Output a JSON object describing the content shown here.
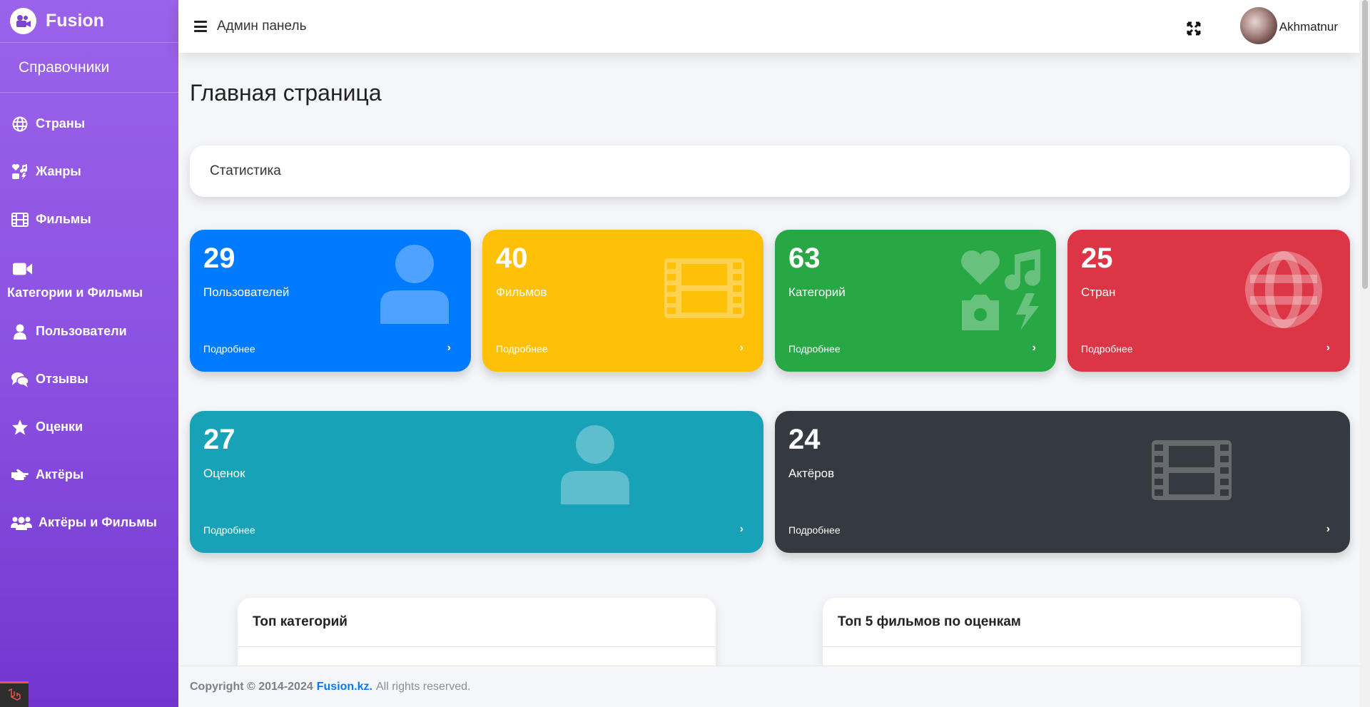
{
  "sidebar": {
    "brand_name": "Fusion",
    "section_title": "Справочники",
    "items": [
      {
        "label": "Страны",
        "icon": "globe-icon"
      },
      {
        "label": "Жанры",
        "icon": "shapes-icon"
      },
      {
        "label": "Фильмы",
        "icon": "film-icon"
      },
      {
        "label": "Категории и Фильмы",
        "icon": "video-camera-icon"
      },
      {
        "label": "Пользователи",
        "icon": "user-icon"
      },
      {
        "label": "Отзывы",
        "icon": "comments-icon"
      },
      {
        "label": "Оценки",
        "icon": "star-icon"
      },
      {
        "label": "Актёры",
        "icon": "hand-icon"
      },
      {
        "label": "Актёры и Фильмы",
        "icon": "users-icon"
      }
    ]
  },
  "header": {
    "title": "Админ панель",
    "username": "Akhmatnur"
  },
  "main": {
    "page_title": "Главная страница",
    "stats_title": "Статистика",
    "cards": [
      {
        "value": "29",
        "label": "Пользователей",
        "more": "Подробнее",
        "color": "#007bff",
        "icon": "user-icon"
      },
      {
        "value": "40",
        "label": "Фильмов",
        "more": "Подробнее",
        "color": "#ffc107",
        "icon": "film-icon"
      },
      {
        "value": "63",
        "label": "Категорий",
        "more": "Подробнее",
        "color": "#28a745",
        "icon": "shapes-icon"
      },
      {
        "value": "25",
        "label": "Стран",
        "more": "Подробнее",
        "color": "#dc3545",
        "icon": "globe-icon"
      },
      {
        "value": "27",
        "label": "Оценок",
        "more": "Подробнее",
        "color": "#17a2b8",
        "icon": "user-icon"
      },
      {
        "value": "24",
        "label": "Актёров",
        "more": "Подробнее",
        "color": "#343a40",
        "icon": "film-icon"
      }
    ],
    "top_categories_title": "Топ категорий",
    "top_films_title": "Топ 5 фильмов по оценкам"
  },
  "footer": {
    "copyright": "Copyright © 2014-2024",
    "brand": "Fusion.kz.",
    "rights": "All rights reserved."
  }
}
